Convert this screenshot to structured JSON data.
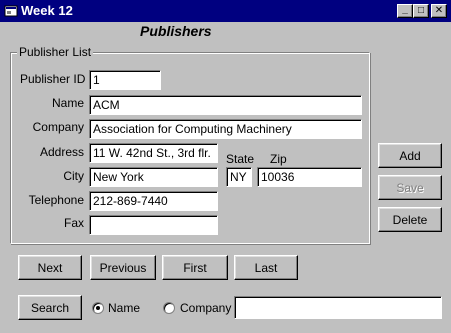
{
  "window": {
    "title": "Week 12",
    "controls": {
      "minimize": "_",
      "maximize": "□",
      "close": "✕"
    }
  },
  "form": {
    "heading": "Publishers"
  },
  "group": {
    "title": "Publisher List"
  },
  "fields": {
    "publisher_id": {
      "label": "Publisher ID",
      "value": "1"
    },
    "name": {
      "label": "Name",
      "value": "ACM"
    },
    "company": {
      "label": "Company",
      "value": "Association for Computing Machinery"
    },
    "address": {
      "label": "Address",
      "value": "11 W. 42nd St., 3rd flr."
    },
    "city": {
      "label": "City",
      "value": "New York"
    },
    "state": {
      "label": "State",
      "value": "NY"
    },
    "zip": {
      "label": "Zip",
      "value": "10036"
    },
    "telephone": {
      "label": "Telephone",
      "value": "212-869-7440"
    },
    "fax": {
      "label": "Fax",
      "value": ""
    }
  },
  "buttons": {
    "add": "Add",
    "save": "Save",
    "delete": "Delete",
    "next": "Next",
    "previous": "Previous",
    "first": "First",
    "last": "Last",
    "search": "Search"
  },
  "search": {
    "options": [
      {
        "label": "Name",
        "selected": true
      },
      {
        "label": "Company",
        "selected": false
      }
    ],
    "value": ""
  },
  "icons": {
    "window": "app-window-icon"
  }
}
